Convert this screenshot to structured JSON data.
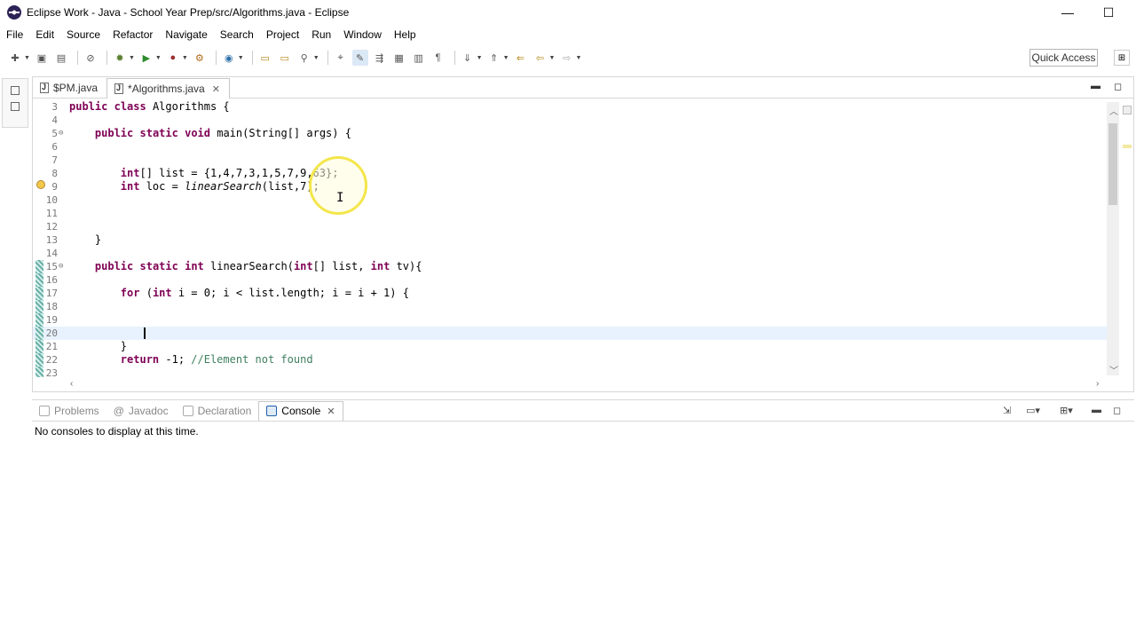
{
  "window": {
    "title": "Eclipse Work - Java - School Year Prep/src/Algorithms.java - Eclipse",
    "minimize": "—",
    "maximize": "☐"
  },
  "menu": [
    "File",
    "Edit",
    "Source",
    "Refactor",
    "Navigate",
    "Search",
    "Project",
    "Run",
    "Window",
    "Help"
  ],
  "toolbar": {
    "quick_access": "Quick Access"
  },
  "editor": {
    "tabs": [
      {
        "label": "$PM.java",
        "active": false
      },
      {
        "label": "*Algorithms.java",
        "active": true
      }
    ],
    "lines": [
      {
        "n": "3",
        "code": "public class Algorithms {"
      },
      {
        "n": "4",
        "code": ""
      },
      {
        "n": "5",
        "code": "    public static void main(String[] args) {"
      },
      {
        "n": "6",
        "code": ""
      },
      {
        "n": "7",
        "code": ""
      },
      {
        "n": "8",
        "code": "        int[] list = {1,4,7,3,1,5,7,9,63};"
      },
      {
        "n": "9",
        "code": "        int loc = linearSearch(list,7);"
      },
      {
        "n": "10",
        "code": ""
      },
      {
        "n": "11",
        "code": ""
      },
      {
        "n": "12",
        "code": ""
      },
      {
        "n": "13",
        "code": "    }"
      },
      {
        "n": "14",
        "code": ""
      },
      {
        "n": "15",
        "code": "    public static int linearSearch(int[] list, int tv){"
      },
      {
        "n": "16",
        "code": ""
      },
      {
        "n": "17",
        "code": "        for (int i = 0; i < list.length; i = i + 1) {"
      },
      {
        "n": "18",
        "code": ""
      },
      {
        "n": "19",
        "code": ""
      },
      {
        "n": "20",
        "code": "            "
      },
      {
        "n": "21",
        "code": "        }"
      },
      {
        "n": "22",
        "code": "        return -1; //Element not found"
      },
      {
        "n": "23",
        "code": ""
      }
    ]
  },
  "console": {
    "tabs": [
      {
        "label": "Problems",
        "active": false
      },
      {
        "label": "Javadoc",
        "active": false
      },
      {
        "label": "Declaration",
        "active": false
      },
      {
        "label": "Console",
        "active": true
      }
    ],
    "message": "No consoles to display at this time."
  }
}
